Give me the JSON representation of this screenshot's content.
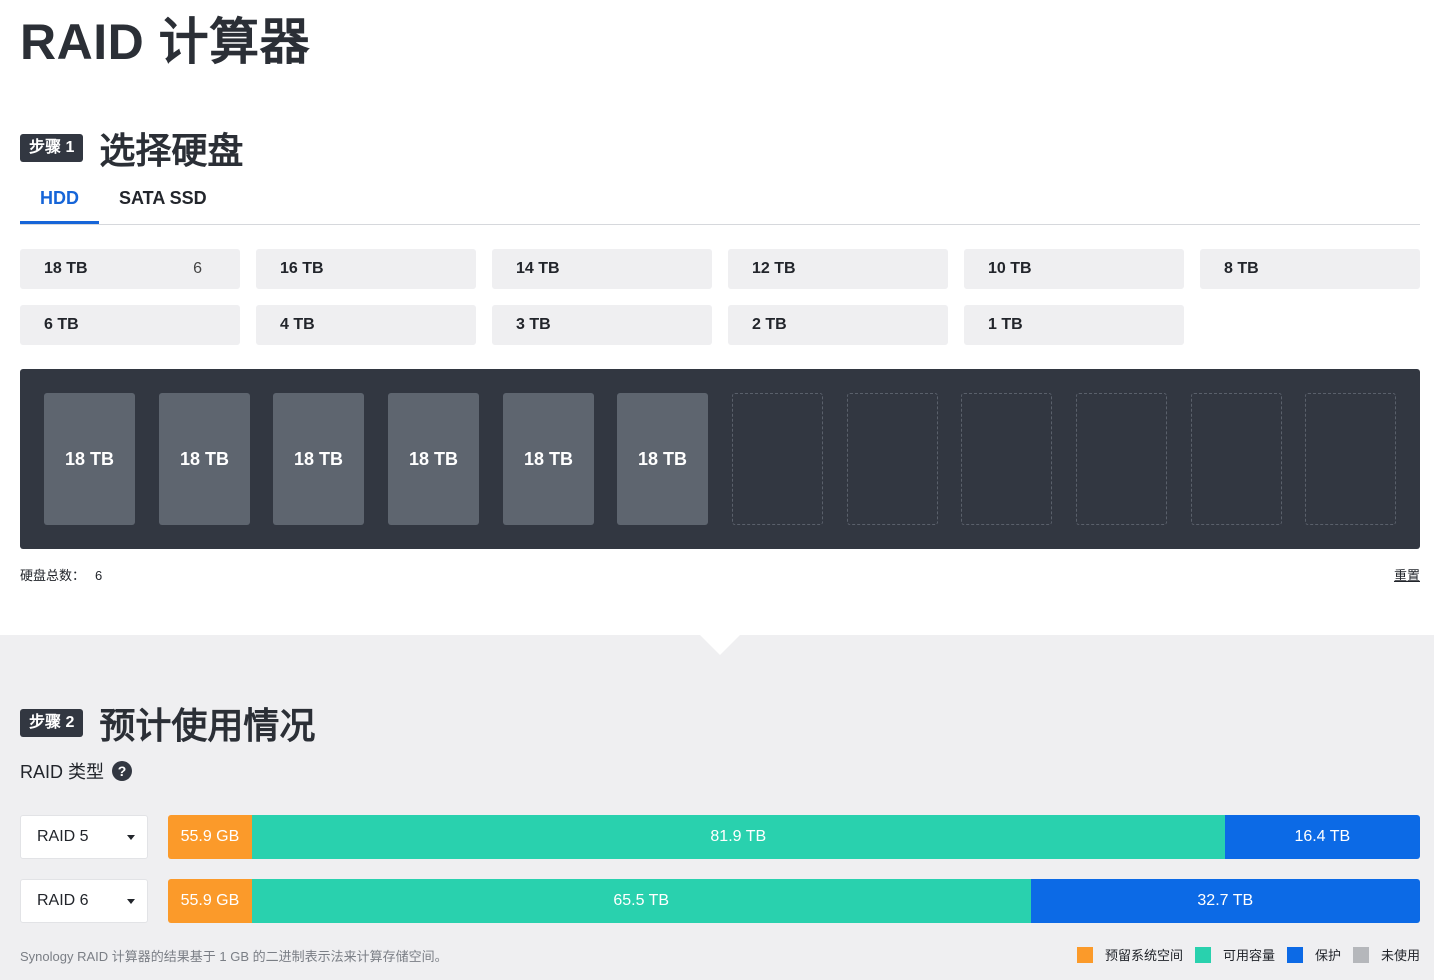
{
  "page": {
    "title": "RAID 计算器"
  },
  "step1": {
    "badge": "步骤 1",
    "title": "选择硬盘",
    "tabs": [
      {
        "label": "HDD",
        "active": true
      },
      {
        "label": "SATA SSD",
        "active": false
      }
    ],
    "sizes": [
      {
        "label": "18 TB",
        "count": "6"
      },
      {
        "label": "16 TB",
        "count": ""
      },
      {
        "label": "14 TB",
        "count": ""
      },
      {
        "label": "12 TB",
        "count": ""
      },
      {
        "label": "10 TB",
        "count": ""
      },
      {
        "label": "8 TB",
        "count": ""
      },
      {
        "label": "6 TB",
        "count": ""
      },
      {
        "label": "4 TB",
        "count": ""
      },
      {
        "label": "3 TB",
        "count": ""
      },
      {
        "label": "2 TB",
        "count": ""
      },
      {
        "label": "1 TB",
        "count": ""
      }
    ],
    "slots": [
      "18 TB",
      "18 TB",
      "18 TB",
      "18 TB",
      "18 TB",
      "18 TB",
      "",
      "",
      "",
      "",
      "",
      ""
    ],
    "total_label": "硬盘总数：",
    "total_value": "6",
    "reset_label": "重置"
  },
  "step2": {
    "badge": "步骤 2",
    "title": "预计使用情况",
    "raid_type_label": "RAID 类型",
    "help_glyph": "?",
    "rows": [
      {
        "raid": "RAID 5",
        "reserved": {
          "label": "55.9 GB",
          "fraction": 0.067
        },
        "usable": {
          "label": "81.9 TB",
          "fraction": 0.777
        },
        "protect": {
          "label": "16.4 TB",
          "fraction": 0.156
        }
      },
      {
        "raid": "RAID 6",
        "reserved": {
          "label": "55.9 GB",
          "fraction": 0.067
        },
        "usable": {
          "label": "65.5 TB",
          "fraction": 0.622
        },
        "protect": {
          "label": "32.7 TB",
          "fraction": 0.311
        }
      }
    ],
    "footnote": "Synology RAID 计算器的结果基于 1 GB 的二进制表示法来计算存储空间。",
    "legend": [
      {
        "label": "预留系统空间",
        "color": "#fb9a2a"
      },
      {
        "label": "可用容量",
        "color": "#29d1ae"
      },
      {
        "label": "保护",
        "color": "#0c6ae6"
      },
      {
        "label": "未使用",
        "color": "#b5b7bb"
      }
    ]
  }
}
